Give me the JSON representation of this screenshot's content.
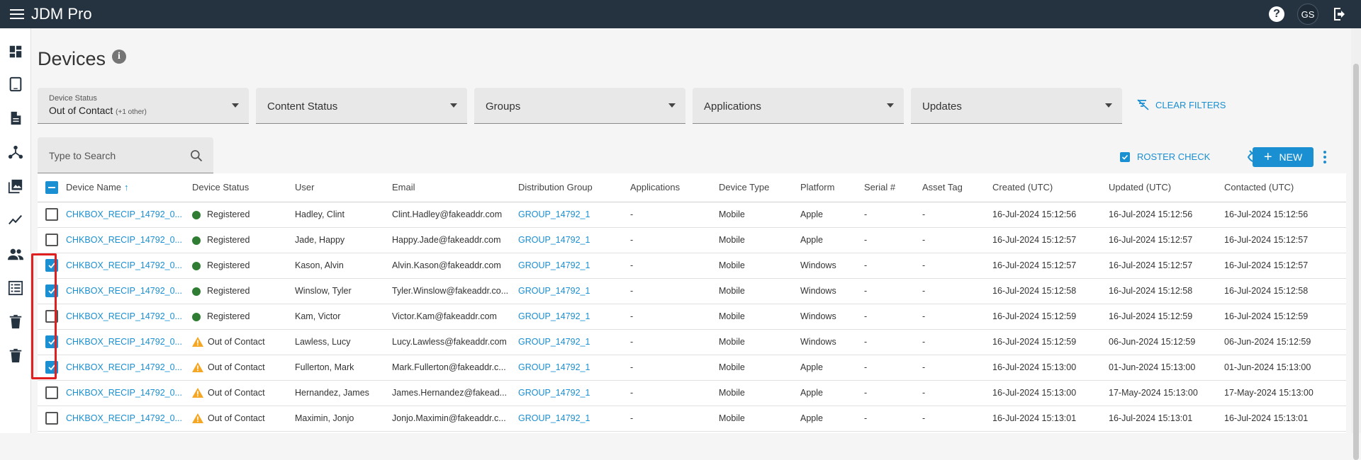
{
  "app": {
    "title": "JDM Pro",
    "avatar_initials": "GS"
  },
  "page": {
    "title": "Devices"
  },
  "filters": [
    {
      "label": "Device Status",
      "value": "Out of Contact",
      "extra": "(+1 other)"
    },
    {
      "label": "Content Status"
    },
    {
      "label": "Groups"
    },
    {
      "label": "Applications"
    },
    {
      "label": "Updates"
    }
  ],
  "clear_filters_label": "CLEAR FILTERS",
  "search": {
    "placeholder": "Type to Search"
  },
  "toolbar": {
    "roster_label": "ROSTER CHECK",
    "roster_checked": true,
    "new_label": "NEW"
  },
  "colors": {
    "accent": "#1a8fd1",
    "topbar": "#253341",
    "registered": "#2e7d32",
    "warning": "#f5a623",
    "highlight": "#e02020"
  },
  "table": {
    "headers": [
      "Device Name",
      "Device Status",
      "User",
      "Email",
      "Distribution Group",
      "Applications",
      "Device Type",
      "Platform",
      "Serial #",
      "Asset Tag",
      "Created (UTC)",
      "Updated (UTC)",
      "Contacted (UTC)"
    ],
    "sort_indicator": "↑",
    "rows": [
      {
        "checked": false,
        "name": "CHKBOX_RECIP_14792_0...",
        "status": "Registered",
        "status_kind": "ok",
        "user": "Hadley, Clint",
        "email": "Clint.Hadley@fakeaddr.com",
        "group": "GROUP_14792_1",
        "apps": "-",
        "type": "Mobile",
        "platform": "Apple",
        "serial": "-",
        "asset": "-",
        "created": "16-Jul-2024 15:12:56",
        "updated": "16-Jul-2024 15:12:56",
        "contacted": "16-Jul-2024 15:12:56"
      },
      {
        "checked": false,
        "name": "CHKBOX_RECIP_14792_0...",
        "status": "Registered",
        "status_kind": "ok",
        "user": "Jade, Happy",
        "email": "Happy.Jade@fakeaddr.com",
        "group": "GROUP_14792_1",
        "apps": "-",
        "type": "Mobile",
        "platform": "Apple",
        "serial": "-",
        "asset": "-",
        "created": "16-Jul-2024 15:12:57",
        "updated": "16-Jul-2024 15:12:57",
        "contacted": "16-Jul-2024 15:12:57"
      },
      {
        "checked": true,
        "name": "CHKBOX_RECIP_14792_0...",
        "status": "Registered",
        "status_kind": "ok",
        "user": "Kason, Alvin",
        "email": "Alvin.Kason@fakeaddr.com",
        "group": "GROUP_14792_1",
        "apps": "-",
        "type": "Mobile",
        "platform": "Windows",
        "serial": "-",
        "asset": "-",
        "created": "16-Jul-2024 15:12:57",
        "updated": "16-Jul-2024 15:12:57",
        "contacted": "16-Jul-2024 15:12:57"
      },
      {
        "checked": true,
        "name": "CHKBOX_RECIP_14792_0...",
        "status": "Registered",
        "status_kind": "ok",
        "user": "Winslow, Tyler",
        "email": "Tyler.Winslow@fakeaddr.co...",
        "group": "GROUP_14792_1",
        "apps": "-",
        "type": "Mobile",
        "platform": "Windows",
        "serial": "-",
        "asset": "-",
        "created": "16-Jul-2024 15:12:58",
        "updated": "16-Jul-2024 15:12:58",
        "contacted": "16-Jul-2024 15:12:58"
      },
      {
        "checked": false,
        "name": "CHKBOX_RECIP_14792_0...",
        "status": "Registered",
        "status_kind": "ok",
        "user": "Kam, Victor",
        "email": "Victor.Kam@fakeaddr.com",
        "group": "GROUP_14792_1",
        "apps": "-",
        "type": "Mobile",
        "platform": "Windows",
        "serial": "-",
        "asset": "-",
        "created": "16-Jul-2024 15:12:59",
        "updated": "16-Jul-2024 15:12:59",
        "contacted": "16-Jul-2024 15:12:59"
      },
      {
        "checked": true,
        "name": "CHKBOX_RECIP_14792_0...",
        "status": "Out of Contact",
        "status_kind": "warn",
        "user": "Lawless, Lucy",
        "email": "Lucy.Lawless@fakeaddr.com",
        "group": "GROUP_14792_1",
        "apps": "-",
        "type": "Mobile",
        "platform": "Windows",
        "serial": "-",
        "asset": "-",
        "created": "16-Jul-2024 15:12:59",
        "updated": "06-Jun-2024 15:12:59",
        "contacted": "06-Jun-2024 15:12:59"
      },
      {
        "checked": true,
        "name": "CHKBOX_RECIP_14792_0...",
        "status": "Out of Contact",
        "status_kind": "warn",
        "user": "Fullerton, Mark",
        "email": "Mark.Fullerton@fakeaddr.c...",
        "group": "GROUP_14792_1",
        "apps": "-",
        "type": "Mobile",
        "platform": "Apple",
        "serial": "-",
        "asset": "-",
        "created": "16-Jul-2024 15:13:00",
        "updated": "01-Jun-2024 15:13:00",
        "contacted": "01-Jun-2024 15:13:00"
      },
      {
        "checked": false,
        "name": "CHKBOX_RECIP_14792_0...",
        "status": "Out of Contact",
        "status_kind": "warn",
        "user": "Hernandez, James",
        "email": "James.Hernandez@fakead...",
        "group": "GROUP_14792_1",
        "apps": "-",
        "type": "Mobile",
        "platform": "Apple",
        "serial": "-",
        "asset": "-",
        "created": "16-Jul-2024 15:13:00",
        "updated": "17-May-2024 15:13:00",
        "contacted": "17-May-2024 15:13:00"
      },
      {
        "checked": false,
        "name": "CHKBOX_RECIP_14792_0...",
        "status": "Out of Contact",
        "status_kind": "warn",
        "user": "Maximin, Jonjo",
        "email": "Jonjo.Maximin@fakeaddr.c...",
        "group": "GROUP_14792_1",
        "apps": "-",
        "type": "Mobile",
        "platform": "Apple",
        "serial": "-",
        "asset": "-",
        "created": "16-Jul-2024 15:13:01",
        "updated": "16-Jul-2024 15:13:01",
        "contacted": "16-Jul-2024 15:13:01"
      }
    ]
  },
  "sidebar": {
    "icons": [
      "dashboard-icon",
      "tablet-icon",
      "document-icon",
      "hierarchy-icon",
      "image-library-icon",
      "trend-icon",
      "people-icon",
      "list-icon",
      "trash-icon",
      "trash-icon-2"
    ]
  }
}
